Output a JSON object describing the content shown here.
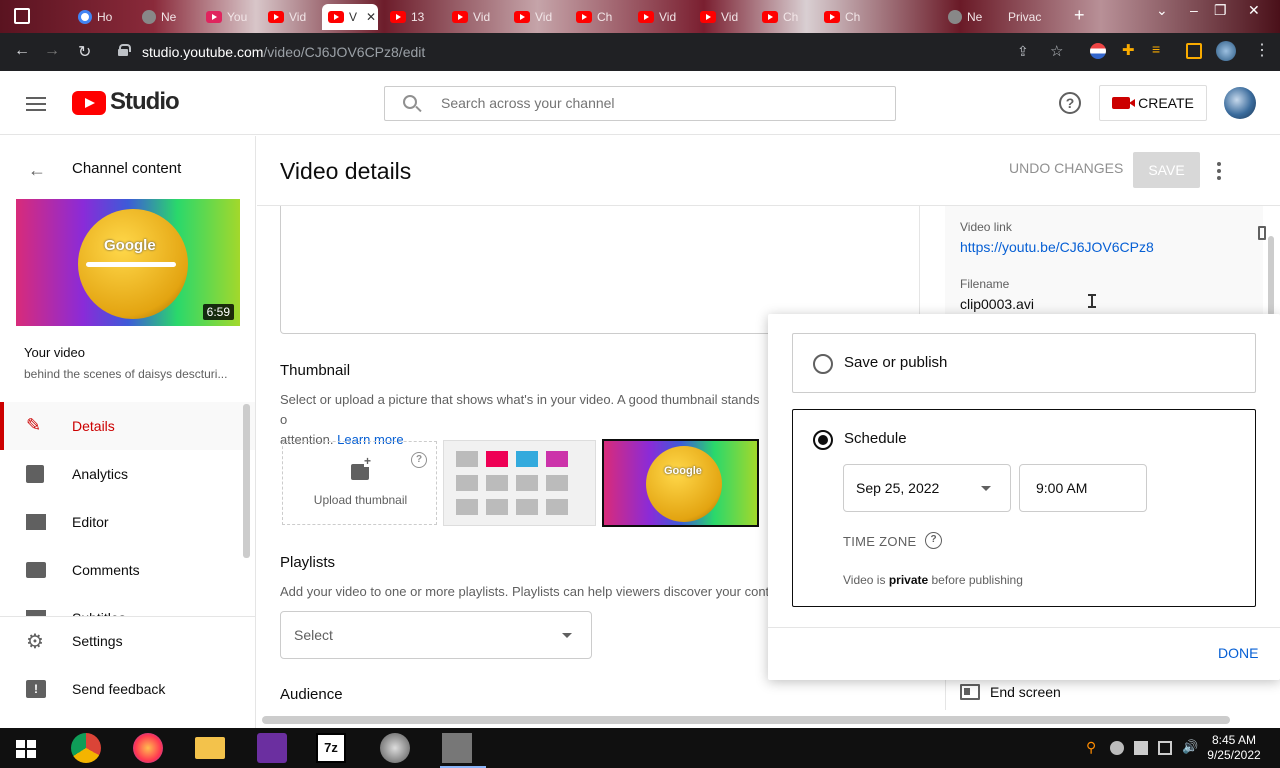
{
  "browser": {
    "tabs": [
      {
        "label": "Ho",
        "icon": "google-icon"
      },
      {
        "label": "Ne",
        "icon": "github-icon"
      },
      {
        "label": "You",
        "icon": "download-icon"
      },
      {
        "label": "Vid",
        "icon": "youtube-icon"
      },
      {
        "label": "V",
        "icon": "youtube-icon",
        "active": true
      },
      {
        "label": "13",
        "icon": "youtube-icon"
      },
      {
        "label": "Vid",
        "icon": "youtube-icon"
      },
      {
        "label": "Vid",
        "icon": "youtube-icon"
      },
      {
        "label": "Ch",
        "icon": "youtube-icon"
      },
      {
        "label": "Vid",
        "icon": "youtube-icon"
      },
      {
        "label": "Vid",
        "icon": "youtube-icon"
      },
      {
        "label": "Ch",
        "icon": "youtube-icon"
      },
      {
        "label": "Ch",
        "icon": "youtube-icon"
      },
      {
        "label": "Ne",
        "icon": "github-icon"
      },
      {
        "label": "Privac",
        "icon": "none"
      }
    ],
    "url_domain": "studio.youtube.com",
    "url_path": "/video/CJ6JOV6CPz8/edit"
  },
  "header": {
    "logo_text": "Studio",
    "search_placeholder": "Search across your channel",
    "create_label": "CREATE"
  },
  "sidebar": {
    "back_label": "Channel content",
    "thumbnail_brand": "Google",
    "duration": "6:59",
    "your_video_label": "Your video",
    "video_title": "behind the scenes of daisys descturi...",
    "nav_items": [
      {
        "label": "Details",
        "icon": "pencil-icon",
        "active": true
      },
      {
        "label": "Analytics",
        "icon": "analytics-icon"
      },
      {
        "label": "Editor",
        "icon": "editor-icon"
      },
      {
        "label": "Comments",
        "icon": "comments-icon"
      },
      {
        "label": "Subtitles",
        "icon": "subtitles-icon"
      }
    ],
    "bottom_items": [
      {
        "label": "Settings",
        "icon": "gear-icon"
      },
      {
        "label": "Send feedback",
        "icon": "feedback-icon"
      }
    ]
  },
  "main": {
    "title": "Video details",
    "undo_label": "UNDO CHANGES",
    "save_label": "SAVE",
    "thumbnail": {
      "title": "Thumbnail",
      "desc": "Select or upload a picture that shows what's in your video. A good thumbnail stands o",
      "desc2": "attention.",
      "learn_more": "Learn more",
      "upload_label": "Upload thumbnail",
      "option_brand": "Google"
    },
    "playlists": {
      "title": "Playlists",
      "desc": "Add your video to one or more playlists. Playlists can help viewers discover your cont",
      "select_value": "Select"
    },
    "audience_title": "Audience",
    "video_link_label": "Video link",
    "video_link": "https://youtu.be/CJ6JOV6CPz8",
    "filename_label": "Filename",
    "filename": "clip0003.avi",
    "end_screen_label": "End screen"
  },
  "visibility_popup": {
    "save_publish_label": "Save or publish",
    "schedule_label": "Schedule",
    "date": "Sep 25, 2022",
    "time": "9:00 AM",
    "timezone_label": "TIME ZONE",
    "private_prefix": "Video is ",
    "private_word": "private",
    "private_suffix": " before publishing",
    "done_label": "DONE"
  },
  "taskbar": {
    "time": "8:45 AM",
    "date": "9/25/2022"
  }
}
